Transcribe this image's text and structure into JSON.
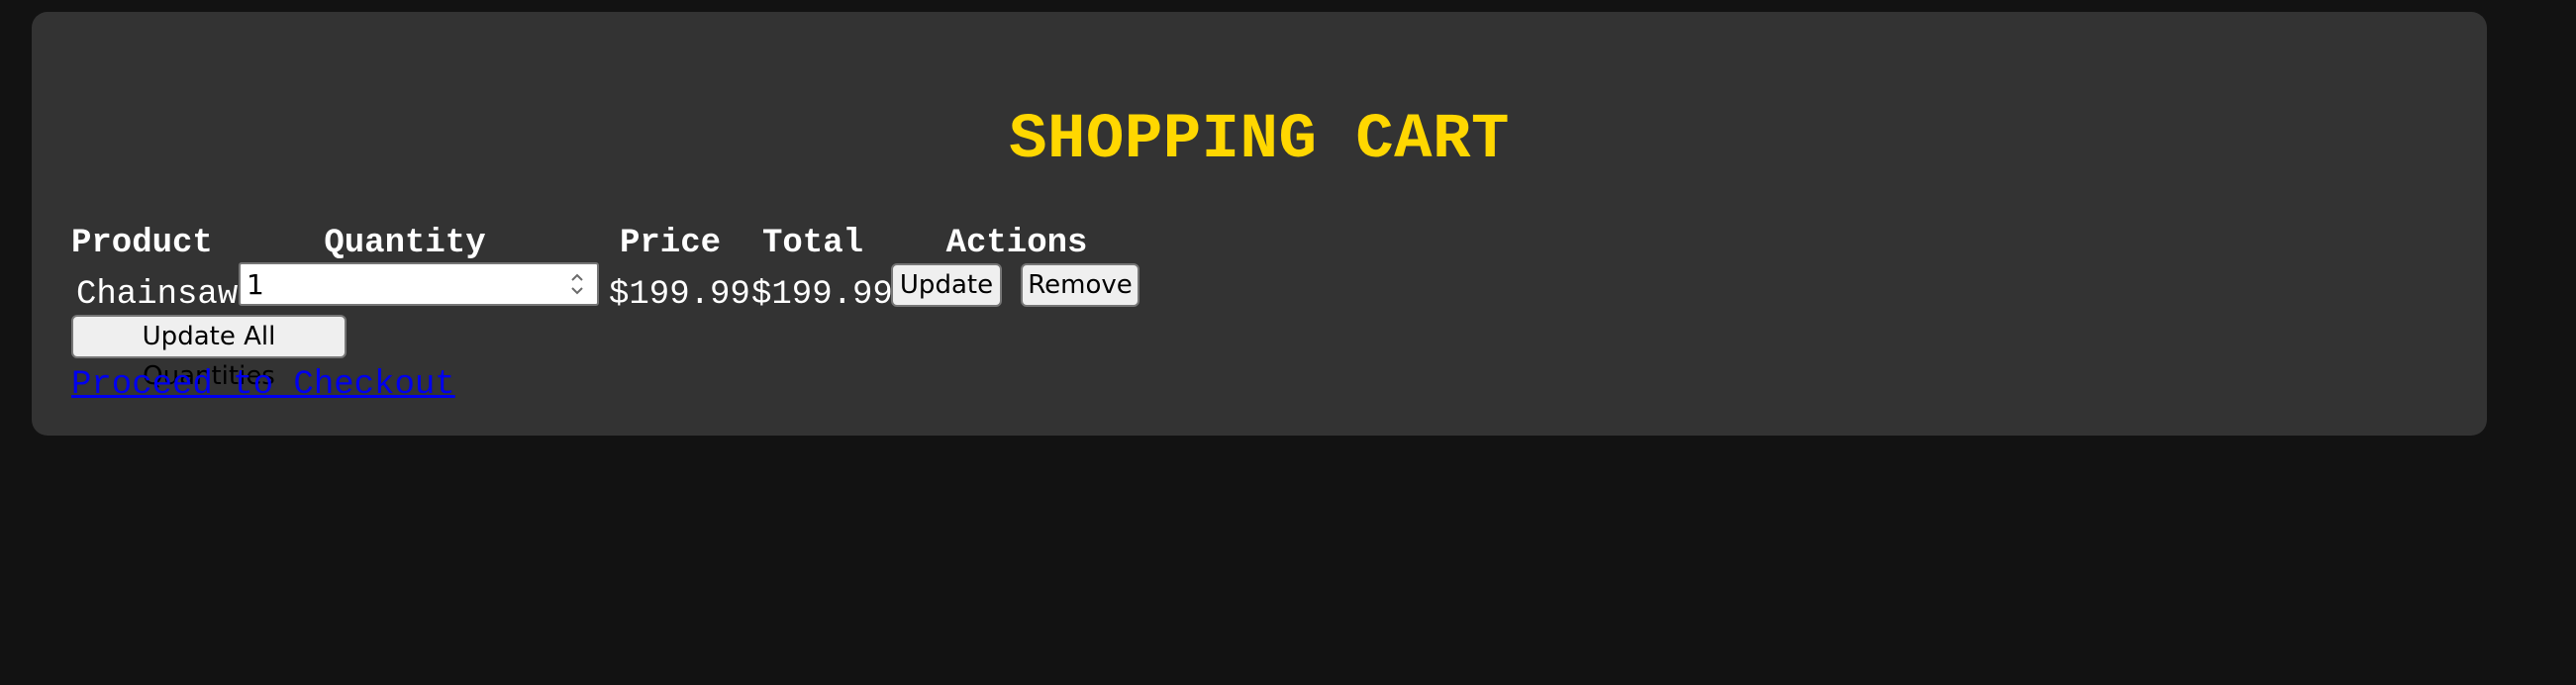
{
  "page": {
    "title": "SHOPPING CART"
  },
  "table": {
    "headers": {
      "product": "Product",
      "quantity": "Quantity",
      "price": "Price",
      "total": "Total",
      "actions": "Actions"
    },
    "rows": [
      {
        "product": "Chainsaw",
        "quantity": "1",
        "price": "$199.99",
        "total": "$199.99",
        "update_label": "Update",
        "remove_label": "Remove"
      }
    ]
  },
  "actions": {
    "update_all_label": "Update All Quantities",
    "checkout_label": "Proceed to Checkout"
  },
  "colors": {
    "page_background": "#121212",
    "card_background": "#333333",
    "title": "#ffd700",
    "text": "#ffffff",
    "link": "#0000ee"
  },
  "icons": {
    "quantity_spinner": "spinner-arrows-icon"
  }
}
